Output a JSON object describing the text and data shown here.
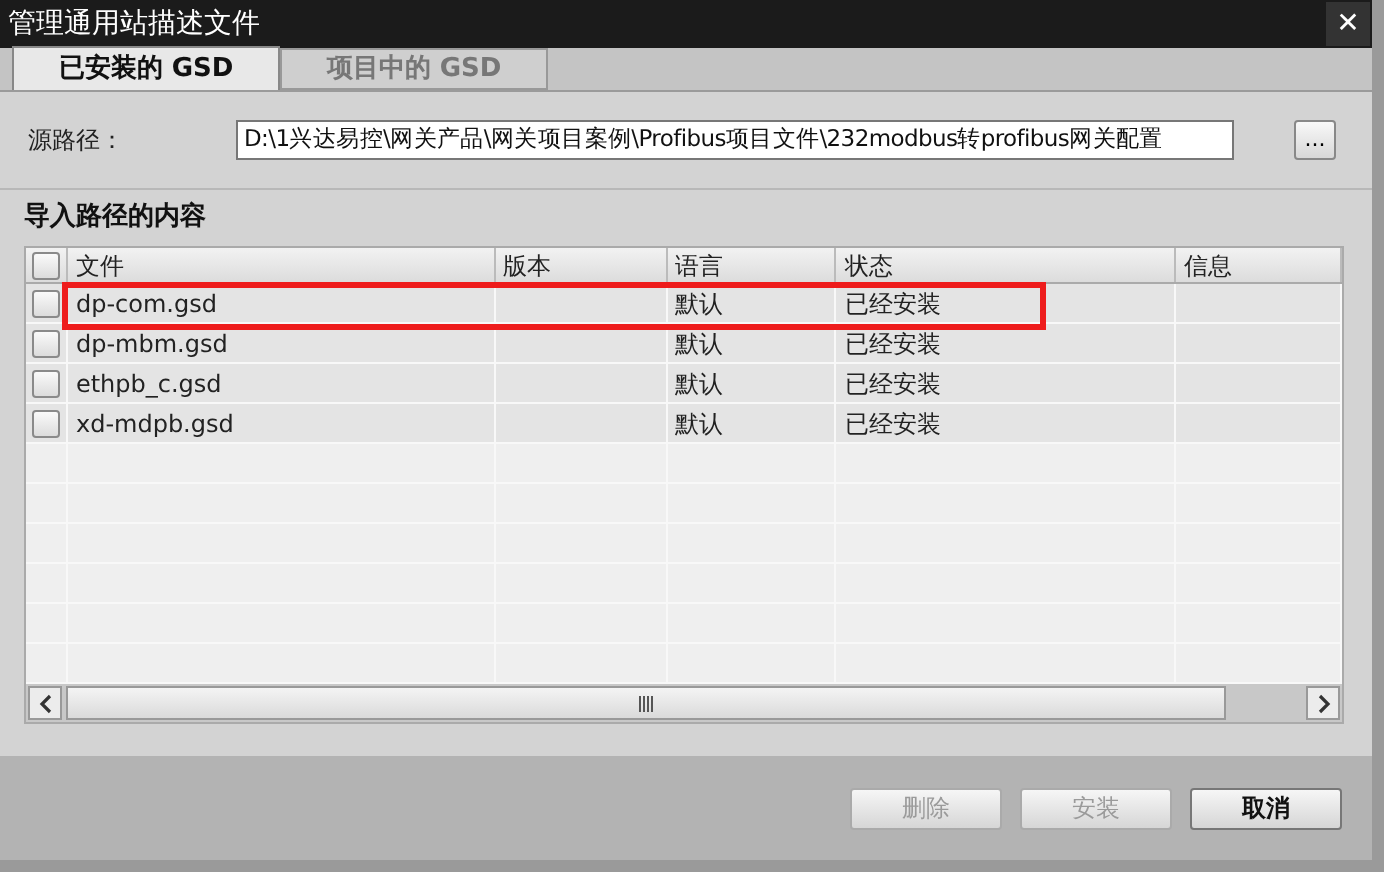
{
  "window": {
    "title": "管理通用站描述文件",
    "close": "✕"
  },
  "tabs": [
    {
      "label": "已安装的 GSD",
      "selected": true
    },
    {
      "label": "项目中的 GSD",
      "selected": false
    }
  ],
  "source_path": {
    "label": "源路径：",
    "value": "D:\\1兴达易控\\网关产品\\网关项目案例\\Profibus项目文件\\232modbus转profibus网关配置",
    "browse": "..."
  },
  "section_title": "导入路径的内容",
  "table": {
    "select_all": {
      "checked": false
    },
    "columns": [
      "文件",
      "版本",
      "语言",
      "状态",
      "信息"
    ],
    "rows": [
      {
        "checked": false,
        "highlighted": true,
        "cells": [
          "dp-com.gsd",
          "",
          "默认",
          "已经安装",
          ""
        ]
      },
      {
        "checked": false,
        "highlighted": false,
        "cells": [
          "dp-mbm.gsd",
          "",
          "默认",
          "已经安装",
          ""
        ]
      },
      {
        "checked": false,
        "highlighted": false,
        "cells": [
          "ethpb_c.gsd",
          "",
          "默认",
          "已经安装",
          ""
        ]
      },
      {
        "checked": false,
        "highlighted": false,
        "cells": [
          "xd-mdpb.gsd",
          "",
          "默认",
          "已经安装",
          ""
        ]
      }
    ]
  },
  "buttons": [
    {
      "label": "删除",
      "disabled": true
    },
    {
      "label": "安装",
      "disabled": true
    },
    {
      "label": "取消",
      "disabled": false
    }
  ]
}
